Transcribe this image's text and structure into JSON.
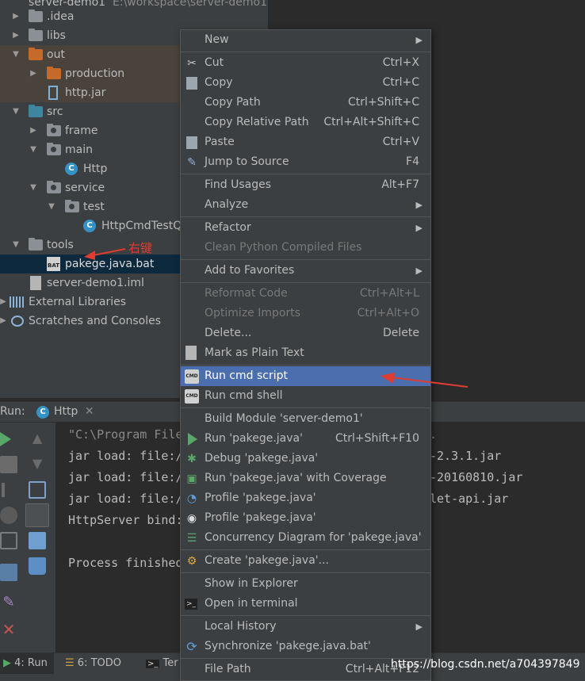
{
  "tree": {
    "project_title": "server-demo1",
    "project_path": "E:\\workspace\\server-demo1",
    "items": [
      {
        "label": ".idea"
      },
      {
        "label": "libs"
      },
      {
        "label": "out"
      },
      {
        "label": "production"
      },
      {
        "label": "http.jar"
      },
      {
        "label": "src"
      },
      {
        "label": "frame"
      },
      {
        "label": "main"
      },
      {
        "label": "Http"
      },
      {
        "label": "service"
      },
      {
        "label": "test"
      },
      {
        "label": "HttpCmdTestQ"
      },
      {
        "label": "tools"
      },
      {
        "label": "pakege.java.bat"
      },
      {
        "label": "server-demo1.iml"
      },
      {
        "label": "External Libraries"
      },
      {
        "label": "Scratches and Consoles"
      }
    ],
    "annotation": "右键"
  },
  "run": {
    "label": "Run:",
    "tab_label": "Http",
    "console_lines": [
      "\"C:\\Program File",
      "jar load: file:/",
      "jar load: file:/",
      "jar load: file:/",
      "HttpServer bind:",
      "",
      "Process finished"
    ],
    "console_right": [
      ".",
      "-2.3.1.jar",
      "-20160810.jar",
      "let-api.jar"
    ]
  },
  "bottom": {
    "tabs": [
      {
        "label": "4: Run"
      },
      {
        "label": "6: TODO"
      },
      {
        "label": "Ter"
      }
    ],
    "watermark": "https://blog.csdn.net/a704397849"
  },
  "menu": {
    "items": [
      {
        "label": "New",
        "key": "",
        "submenu": true
      },
      {
        "label": "Cut",
        "key": "Ctrl+X",
        "icon": "scissors-icon"
      },
      {
        "label": "Copy",
        "key": "Ctrl+C",
        "icon": "copy-icon"
      },
      {
        "label": "Copy Path",
        "key": "Ctrl+Shift+C"
      },
      {
        "label": "Copy Relative Path",
        "key": "Ctrl+Alt+Shift+C"
      },
      {
        "label": "Paste",
        "key": "Ctrl+V",
        "icon": "paste-icon"
      },
      {
        "label": "Jump to Source",
        "key": "F4",
        "icon": "jump-to-source-icon"
      },
      {
        "label": "Find Usages",
        "key": "Alt+F7"
      },
      {
        "label": "Analyze",
        "key": "",
        "submenu": true
      },
      {
        "label": "Refactor",
        "key": "",
        "submenu": true
      },
      {
        "label": "Clean Python Compiled Files",
        "key": "",
        "disabled": true
      },
      {
        "label": "Add to Favorites",
        "key": "",
        "submenu": true
      },
      {
        "label": "Reformat Code",
        "key": "Ctrl+Alt+L",
        "disabled": true
      },
      {
        "label": "Optimize Imports",
        "key": "Ctrl+Alt+O",
        "disabled": true
      },
      {
        "label": "Delete...",
        "key": "Delete"
      },
      {
        "label": "Mark as Plain Text",
        "key": "",
        "icon": "plain-text-icon"
      },
      {
        "label": "Run cmd script",
        "key": "",
        "icon": "cmd-icon",
        "highlighted": true
      },
      {
        "label": "Run cmd shell",
        "key": "",
        "icon": "cmd-icon"
      },
      {
        "label": "Build Module 'server-demo1'",
        "key": ""
      },
      {
        "label": "Run 'pakege.java'",
        "key": "Ctrl+Shift+F10",
        "icon": "run-icon"
      },
      {
        "label": "Debug 'pakege.java'",
        "key": "",
        "icon": "debug-icon"
      },
      {
        "label": "Run 'pakege.java' with Coverage",
        "key": "",
        "icon": "coverage-icon"
      },
      {
        "label": "Profile 'pakege.java'",
        "key": "",
        "icon": "profile-icon"
      },
      {
        "label": "Profile 'pakege.java'",
        "key": "",
        "icon": "profile-alt-icon"
      },
      {
        "label": "Concurrency Diagram for 'pakege.java'",
        "key": "",
        "icon": "concurrency-icon"
      },
      {
        "label": "Create 'pakege.java'...",
        "key": "",
        "icon": "create-config-icon"
      },
      {
        "label": "Show in Explorer",
        "key": ""
      },
      {
        "label": "Open in terminal",
        "key": "",
        "icon": "terminal-icon"
      },
      {
        "label": "Local History",
        "key": "",
        "submenu": true
      },
      {
        "label": "Synchronize 'pakege.java.bat'",
        "key": "",
        "icon": "sync-icon"
      },
      {
        "label": "File Path",
        "key": "Ctrl+Alt+F12"
      }
    ],
    "submenu_glyph": "▶"
  },
  "colors": {
    "tree_bg": "#3c3f41",
    "selection": "#0d293e",
    "menu_highlight": "#4b6eaf",
    "annotation_red": "#e03c32"
  }
}
